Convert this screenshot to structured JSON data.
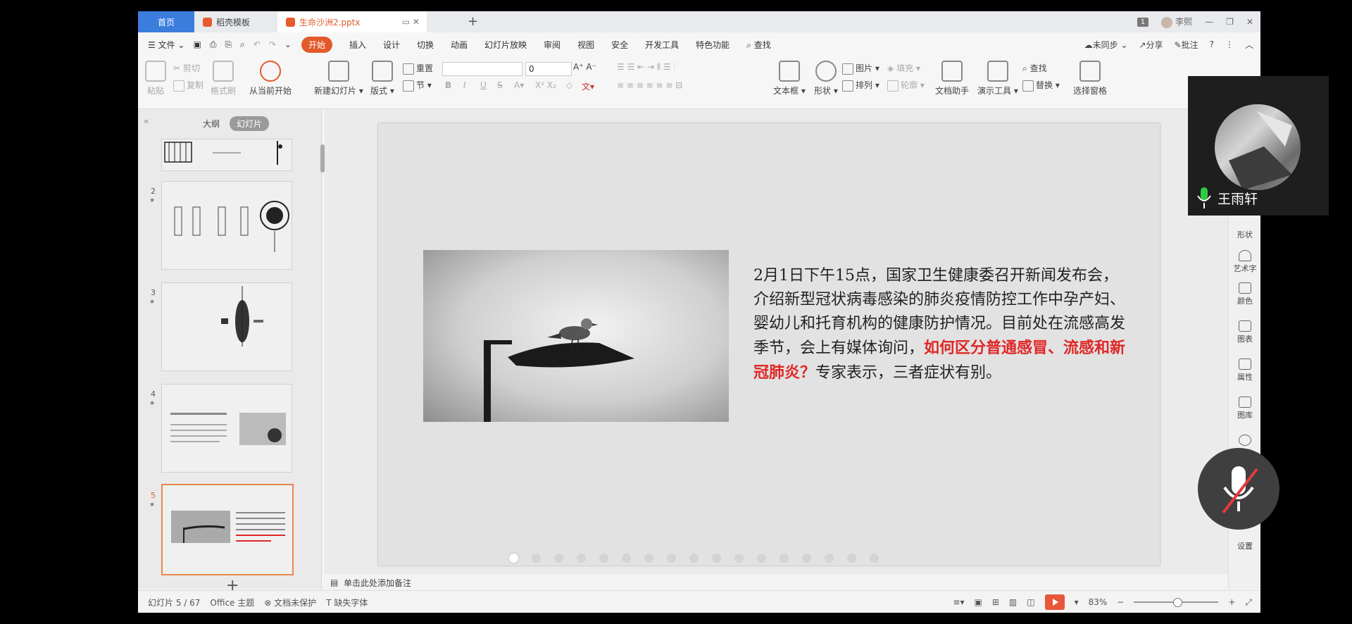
{
  "titlebar": {
    "tab_home": "首页",
    "tab_template": "稻壳模板",
    "tab_doc": "生命沙洲2.pptx",
    "page_badge": "1",
    "user": "李熙"
  },
  "menu": {
    "file": "文件",
    "items": [
      "开始",
      "插入",
      "设计",
      "切换",
      "动画",
      "幻灯片放映",
      "审阅",
      "视图",
      "安全",
      "开发工具",
      "特色功能"
    ],
    "search": "查找",
    "unsynced": "未同步",
    "share": "分享",
    "annotate": "批注"
  },
  "ribbon": {
    "paste": "粘贴",
    "cut": "剪切",
    "copy": "复制",
    "format_painter": "格式刷",
    "from_current": "从当前开始",
    "new_slide": "新建幻灯片",
    "layout": "版式",
    "reset": "重置",
    "section": "节",
    "font_size": "0",
    "text_box": "文本框",
    "shape": "形状",
    "arrange": "排列",
    "picture": "图片",
    "fill": "填充",
    "outline": "轮廓",
    "doc_assistant": "文档助手",
    "presentation_tools": "演示工具",
    "find": "查找",
    "replace": "替换",
    "select_pane": "选择窗格"
  },
  "left_panel": {
    "outline_tab": "大纲",
    "slides_tab": "幻灯片",
    "thumbs": [
      {
        "num": ""
      },
      {
        "num": "2"
      },
      {
        "num": "3"
      },
      {
        "num": "4"
      },
      {
        "num": "5"
      }
    ]
  },
  "slide": {
    "text_part1": "2月1日下午15点，国家卫生健康委召开新闻发布会，介绍新型冠状病毒感染的肺炎疫情防控工作中孕产妇、婴幼儿和托育机构的健康防护情况。目前处在流感高发季节，会上有媒体询问，",
    "text_highlight": "如何区分普通感冒、流感和新冠肺炎？",
    "text_part2": "专家表示，三者症状有别。",
    "highlight_color": "#e02727",
    "dot_count": 17
  },
  "notes": {
    "placeholder": "单击此处添加备注"
  },
  "right_panel": {
    "items": [
      "形状",
      "艺术字",
      "颜色",
      "图表",
      "属性",
      "图库",
      "网络",
      "设置"
    ]
  },
  "status": {
    "slide_count": "幻灯片 5 / 67",
    "theme": "Office 主题",
    "protection": "文档未保护",
    "missing_font": "缺失字体",
    "zoom": "83%"
  },
  "video": {
    "name": "王雨轩"
  },
  "colors": {
    "accent": "#e25a2b",
    "home_tab": "#3b7ddd"
  }
}
